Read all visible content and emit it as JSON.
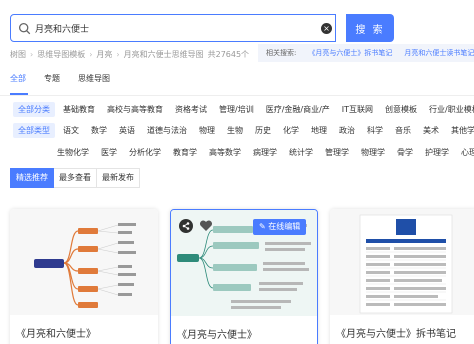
{
  "search": {
    "value": "月亮和六便士",
    "button_label": "搜 索"
  },
  "breadcrumb": {
    "items": [
      "树图",
      "思维导图模板",
      "月亮",
      "月亮和六便士思维导图"
    ],
    "count": "共27645个"
  },
  "related": {
    "label": "相关搜索:",
    "links": [
      "《月亮与六便士》拆书笔记",
      "月亮和六便士读书笔记"
    ]
  },
  "tabs": [
    {
      "label": "全部",
      "active": true
    },
    {
      "label": "专题",
      "active": false
    },
    {
      "label": "思维导图",
      "active": false
    }
  ],
  "category_row": {
    "active": "全部分类",
    "items": [
      "基础教育",
      "高校与高等教育",
      "资格考试",
      "管理/培训",
      "医疗/金融/商业/产",
      "IT互联网",
      "创意模板",
      "行业/职业模板"
    ]
  },
  "type_row": {
    "active": "全部类型",
    "items": [
      "语文",
      "数学",
      "英语",
      "道德与法治",
      "物理",
      "生物",
      "历史",
      "化学",
      "地理",
      "政治",
      "科学",
      "音乐",
      "美术",
      "其他学"
    ]
  },
  "type_row_2": {
    "items": [
      "生物化学",
      "医学",
      "分析化学",
      "教育学",
      "高等数学",
      "病理学",
      "统计学",
      "管理学",
      "物理学",
      "骨学",
      "护理学",
      "心理学"
    ]
  },
  "sort": {
    "items": [
      "精选推荐",
      "最多查看",
      "最新发布"
    ]
  },
  "cards": [
    {
      "title": "《月亮和六便士》"
    },
    {
      "title": "《月亮与六便士》",
      "edit_label": "在线编辑"
    },
    {
      "title": "《月亮与六便士》拆书笔记"
    }
  ],
  "colors": {
    "accent": "#4a7cff",
    "chip_bg": "#e8efff"
  }
}
